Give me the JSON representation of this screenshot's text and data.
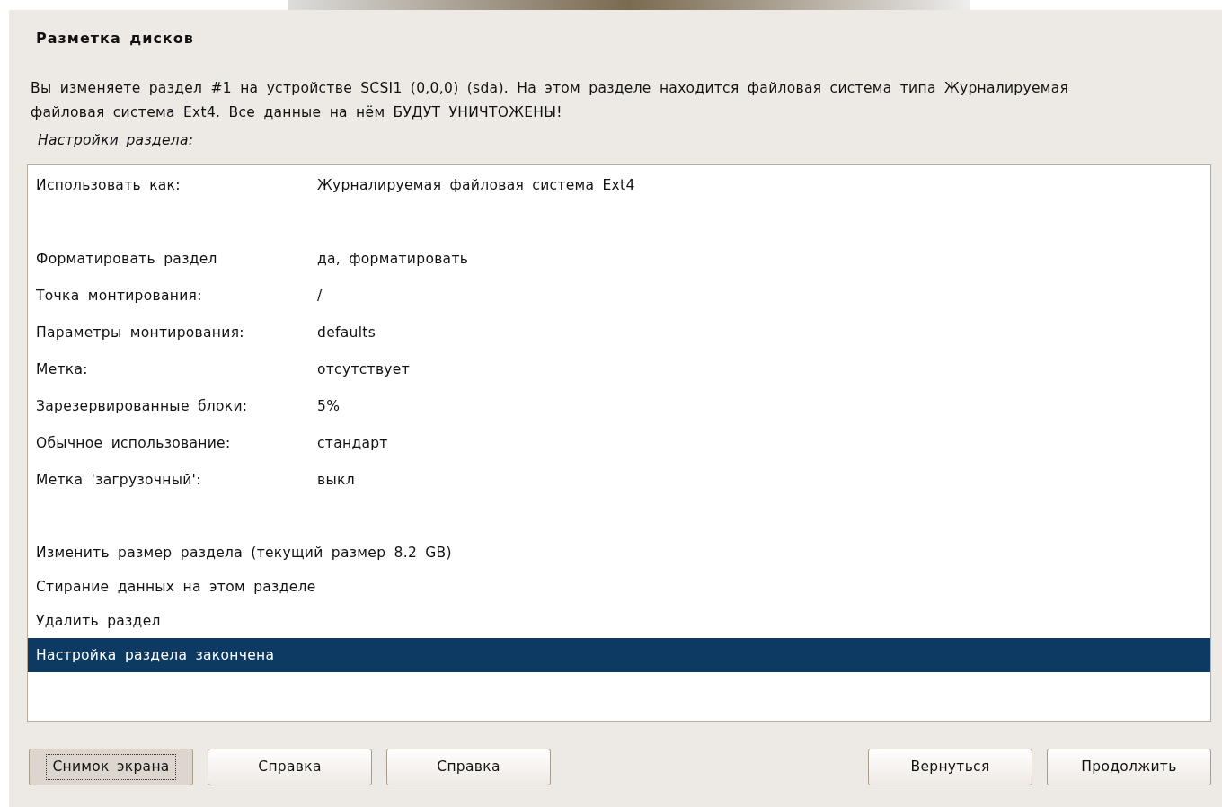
{
  "title": "Разметка дисков",
  "description": "Вы изменяете раздел #1 на устройстве SCSI1 (0,0,0) (sda). На этом разделе находится файловая система типа Журналируемая файловая система Ext4. Все данные на нём БУДУТ УНИЧТОЖЕНЫ!",
  "list_heading": "Настройки раздела:",
  "items": [
    {
      "kind": "setting",
      "label": "Использовать как:",
      "value": "Журналируемая файловая система Ext4",
      "selected": false
    },
    {
      "kind": "blank"
    },
    {
      "kind": "setting",
      "label": "Форматировать раздел",
      "value": "да, форматировать",
      "selected": false
    },
    {
      "kind": "setting",
      "label": "Точка монтирования:",
      "value": "/",
      "selected": false
    },
    {
      "kind": "setting",
      "label": "Параметры монтирования:",
      "value": "defaults",
      "selected": false
    },
    {
      "kind": "setting",
      "label": "Метка:",
      "value": "отсутствует",
      "selected": false
    },
    {
      "kind": "setting",
      "label": "Зарезервированные блоки:",
      "value": "5%",
      "selected": false
    },
    {
      "kind": "setting",
      "label": "Обычное использование:",
      "value": "стандарт",
      "selected": false
    },
    {
      "kind": "setting",
      "label": "Метка 'загрузочный':",
      "value": "выкл",
      "selected": false
    },
    {
      "kind": "blank"
    },
    {
      "kind": "action",
      "label": "Изменить размер раздела (текущий размер 8.2 GB)",
      "selected": false
    },
    {
      "kind": "action",
      "label": "Стирание данных на этом разделе",
      "selected": false
    },
    {
      "kind": "action",
      "label": "Удалить раздел",
      "selected": false
    },
    {
      "kind": "action",
      "label": "Настройка раздела закончена",
      "selected": true
    }
  ],
  "buttons_left": [
    {
      "label": "Снимок экрана",
      "focused": true
    },
    {
      "label": "Справка",
      "focused": false
    },
    {
      "label": "Справка",
      "focused": false
    }
  ],
  "buttons_right": [
    {
      "label": "Вернуться",
      "focused": false
    },
    {
      "label": "Продолжить",
      "focused": false
    }
  ]
}
